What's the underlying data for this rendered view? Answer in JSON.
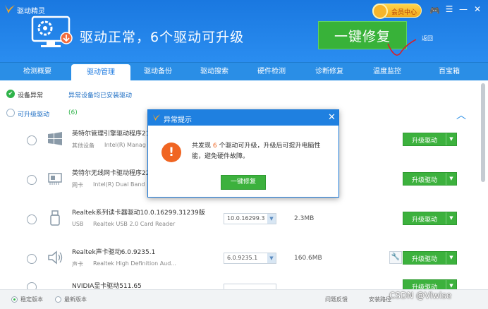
{
  "app": {
    "title": "驱动精灵"
  },
  "header": {
    "vip_label": "会员中心",
    "status_text": "驱动正常，6个驱动可升级",
    "one_click_label": "一键修复",
    "back_label": "返回"
  },
  "tabs": [
    {
      "label": "检测概要",
      "active": false
    },
    {
      "label": "驱动管理",
      "active": true
    },
    {
      "label": "驱动备份",
      "active": false
    },
    {
      "label": "驱动搜索",
      "active": false
    },
    {
      "label": "硬件检测",
      "active": false
    },
    {
      "label": "诊断修复",
      "active": false
    },
    {
      "label": "温度监控",
      "active": false
    },
    {
      "label": "百宝箱",
      "active": false
    }
  ],
  "summary": {
    "abnormal_label": "设备异常",
    "abnormal_status": "异常设备均已安装驱动",
    "upgradable_label": "可升级驱动",
    "upgradable_count": "(6)"
  },
  "drivers": [
    {
      "name": "英特尔管理引擎驱动程序21",
      "category": "其他设备",
      "desc": "Intel(R) Manag",
      "version": "",
      "size": "",
      "action": "升级驱动",
      "icon": "windows-icon",
      "has_wrench": false
    },
    {
      "name": "英特尔无线网卡驱动程序22",
      "category": "网卡",
      "desc": "Intel(R) Dual Band",
      "version": "",
      "size": "",
      "action": "升级驱动",
      "icon": "network-card-icon",
      "has_wrench": false
    },
    {
      "name": "Realtek系列读卡器驱动10.0.16299.31239版",
      "category": "USB",
      "desc": "Realtek USB 2.0 Card Reader",
      "version": "10.0.16299.3",
      "size": "2.3MB",
      "action": "升级驱动",
      "icon": "usb-icon",
      "has_wrench": false
    },
    {
      "name": "Realtek声卡驱动6.0.9235.1",
      "category": "声卡",
      "desc": "Realtek High Definition Aud...",
      "version": "6.0.9235.1",
      "size": "160.6MB",
      "action": "升级驱动",
      "icon": "speaker-icon",
      "has_wrench": true
    },
    {
      "name": "NVIDIA显卡驱动511.65",
      "category": "",
      "desc": "",
      "version": "",
      "size": "",
      "action": "升级驱动",
      "icon": "",
      "has_wrench": false
    }
  ],
  "footer": {
    "stable_label": "稳定版本",
    "latest_label": "最新版本",
    "feedback_label": "问题反馈",
    "install_path_label": "安装路径"
  },
  "dialog": {
    "title": "异常提示",
    "msg_prefix": "共发现",
    "msg_count": "6",
    "msg_suffix": "个驱动可升级，升级后可提升电脑性能，避免硬件故障。",
    "button_label": "一键修复"
  },
  "watermark": "CSDN @Viwise",
  "colors": {
    "brand_blue": "#1f80e0",
    "action_green": "#3cb13d",
    "warning_orange": "#f06522"
  }
}
